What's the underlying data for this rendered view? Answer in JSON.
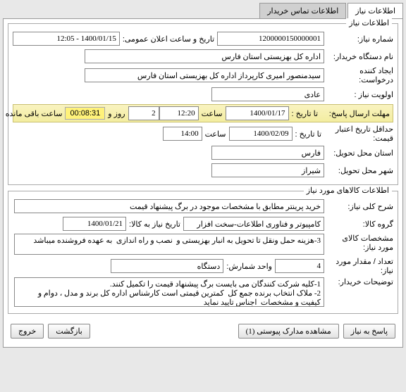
{
  "tabs": {
    "active": "اطلاعات نیاز",
    "other": "اطلاعات تماس خریدار"
  },
  "need_info": {
    "section_title": "اطلاعات نیاز",
    "req_no_label": "شماره نیاز:",
    "req_no": "1200000150000001",
    "pub_datetime_label": "تاریخ و ساعت اعلان عمومی:",
    "pub_datetime": "1400/01/15 - 12:05",
    "buyer_label": "نام دستگاه خریدار:",
    "buyer": "اداره کل بهزیستی استان فارس",
    "requester_label": "ایجاد کننده درخواست:",
    "requester": "سیدمنصور امیری کارپرداز اداره کل بهزیستی استان فارس",
    "priority_label": "اولویت نیاز :",
    "priority": "عادی",
    "deadline_label": "مهلت ارسال پاسخ:",
    "deadline_to_date_label": "تا تاریخ :",
    "deadline_date": "1400/01/17",
    "time_label": "ساعت",
    "deadline_time": "12:20",
    "remain_day": "2",
    "remain_day_label": "روز و",
    "remain_time": "00:08:31",
    "remain_time_label": "ساعت باقی مانده",
    "validity_label": "حداقل تاریخ اعتبار قیمت:",
    "validity_to_date_label": "تا تاریخ :",
    "validity_date": "1400/02/09",
    "validity_time": "14:00",
    "deliver_province_label": "استان محل تحویل:",
    "deliver_province": "فارس",
    "deliver_city_label": "شهر محل تحویل:",
    "deliver_city": "شیراز"
  },
  "goods_info": {
    "section_title": "اطلاعات کالاهای مورد نیاز",
    "desc_label": "شرح کلی نیاز:",
    "desc": "خرید پرینتر مطابق با مشخصات موجود در برگ پیشنهاد قیمت",
    "group_label": "گروه کالا:",
    "group": "کامپیوتر و فناوری اطلاعات-سخت افزار",
    "goods_date_label": "تاریخ نیاز به کالا:",
    "goods_date": "1400/01/21",
    "spec_label": "مشخصات کالای مورد نیاز:",
    "spec": "3-هزینه حمل ونقل تا تحویل به انبار بهزیستی و  نصب و راه اندازی  به عهده فروشنده میباشد",
    "qty_label": "تعداد / مقدار مورد نیاز:",
    "qty": "4",
    "unit_label": "واحد شمارش:",
    "unit": "دستگاه",
    "notes_label": "توضیحات خریدار:",
    "notes": "1-کلیه شرکت کنندگان می بایست برگ پیشنهاد قیمت را تکمیل کنند.\n2- ملاک انتخاب برنده جمع کل  کمترین قیمتی است کارشناس اداره کل برند و مدل ، دوام و کیفیت و مشخصات  اجناس تایید نماید"
  },
  "buttons": {
    "reply": "پاسخ به نیاز",
    "attach": "مشاهده مدارک پیوستی (1)",
    "back": "بازگشت",
    "exit": "خروج"
  }
}
